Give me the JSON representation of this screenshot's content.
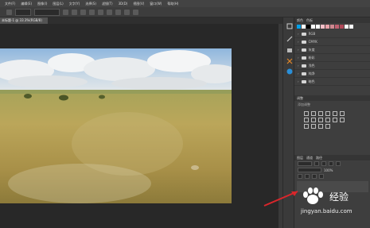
{
  "menubar": {
    "items": [
      "文件(F)",
      "编辑(E)",
      "图像(I)",
      "图层(L)",
      "文字(Y)",
      "选择(S)",
      "滤镜(T)",
      "3D(D)",
      "视图(V)",
      "窗口(W)",
      "帮助(H)"
    ]
  },
  "document": {
    "tab_label": "未标题-1 @ 33.3%(RGB/8)"
  },
  "panels": {
    "tabs": [
      "颜色",
      "色板"
    ],
    "swatches": [
      "#00a0e9",
      "#ffffff",
      "#000000",
      "#ffffff",
      "#ffffff",
      "#f8c0c8",
      "#e8a0a8",
      "#d08890",
      "#c06070",
      "#b04858",
      "#ffffff",
      "#ffffff"
    ],
    "folders": [
      "RGB",
      "CMYK",
      "灰度",
      "粉彩",
      "浅色",
      "纯净",
      "暗色"
    ],
    "adjustments_tab": "调整",
    "adjustments_hint": "添加调整",
    "layers_tabs": [
      "图层",
      "通道",
      "路径"
    ],
    "layer_opacity": "100%"
  },
  "watermark": {
    "logo": "Bai",
    "text": "经验",
    "url": "jingyan.baidu.com"
  },
  "colors": {
    "accent": "#00a0e9",
    "arrow": "#d9262b"
  }
}
